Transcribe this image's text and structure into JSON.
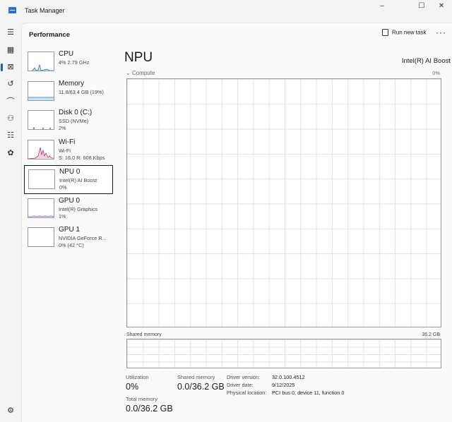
{
  "window": {
    "title": "Task Manager",
    "minimize": "–",
    "maximize": "☐",
    "close": "✕"
  },
  "nav": {
    "menu": "☰",
    "processes": "▦",
    "performance": "⊠",
    "history": "↺",
    "startup": "⌒",
    "users": "⚇",
    "details": "☷",
    "services": "✿",
    "settings": "⚙"
  },
  "header": {
    "title": "Performance",
    "run_new_task": "Run new task",
    "more": "···"
  },
  "devices": [
    {
      "name": "CPU",
      "sub": "4% 2.79 GHz",
      "sub2": "",
      "color": "#1c73c8"
    },
    {
      "name": "Memory",
      "sub": "11.8/63.4 GB (19%)",
      "sub2": "",
      "color": "#1c73c8"
    },
    {
      "name": "Disk 0 (C:)",
      "sub": "SSD (NVMe)",
      "sub2": "2%",
      "color": "#4a8a25"
    },
    {
      "name": "Wi-Fi",
      "sub": "Wi-Fi",
      "sub2": "S: 16.0  R: 608 Kbps",
      "color": "#b3306f"
    },
    {
      "name": "NPU 0",
      "sub": "Intel(R) AI Boost",
      "sub2": "0%",
      "color": "#1c73c8"
    },
    {
      "name": "GPU 0",
      "sub": "Intel(R) Graphics",
      "sub2": "1%",
      "color": "#8a3fd0"
    },
    {
      "name": "GPU 1",
      "sub": "NVIDIA GeForce R...",
      "sub2": "0%  (42 °C)",
      "color": "#8a3fd0"
    }
  ],
  "main": {
    "title": "NPU",
    "device": "Intel(R) AI Boost",
    "graph_label": "Compute",
    "graph_max": "0%",
    "shared_label": "Shared memory",
    "shared_max": "36.2 GB"
  },
  "stats": {
    "utilization_label": "Utilization",
    "utilization_value": "0%",
    "shared_label": "Shared memory",
    "shared_value": "0.0/36.2 GB",
    "total_label": "Total memory",
    "total_value": "0.0/36.2 GB"
  },
  "info": {
    "driver_version_key": "Driver version:",
    "driver_version_val": "32.0.100.4512",
    "driver_date_key": "Driver date:",
    "driver_date_val": "9/12/2025",
    "physical_location_key": "Physical location:",
    "physical_location_val": "PCI bus 0, device 11, function 0"
  }
}
